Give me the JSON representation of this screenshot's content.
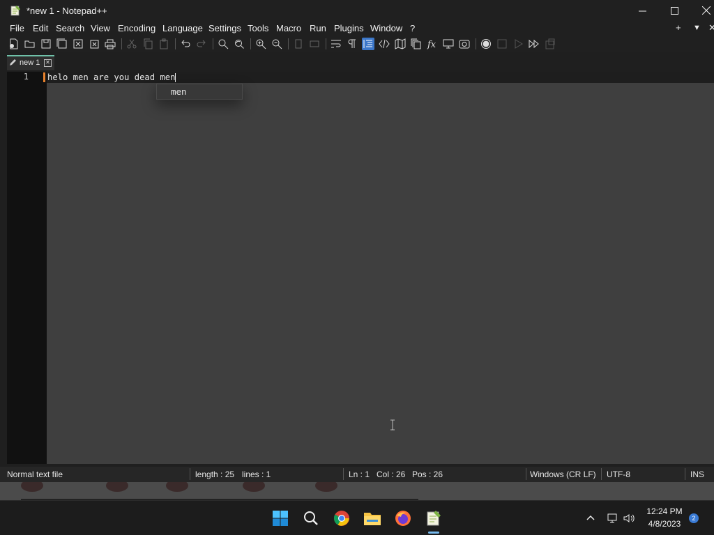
{
  "window": {
    "title": "*new 1 - Notepad++"
  },
  "menu": [
    {
      "label": "File"
    },
    {
      "label": "Edit"
    },
    {
      "label": "Search"
    },
    {
      "label": "View"
    },
    {
      "label": "Encoding"
    },
    {
      "label": "Language"
    },
    {
      "label": "Settings"
    },
    {
      "label": "Tools"
    },
    {
      "label": "Macro"
    },
    {
      "label": "Run"
    },
    {
      "label": "Plugins"
    },
    {
      "label": "Window"
    },
    {
      "label": "?"
    }
  ],
  "menu_right": {
    "add": "+",
    "list": "▼",
    "close": "✕"
  },
  "toolbar": [
    {
      "icon": "new-file-icon"
    },
    {
      "icon": "open-folder-icon"
    },
    {
      "icon": "save-icon"
    },
    {
      "icon": "save-all-icon"
    },
    {
      "icon": "close-file-icon"
    },
    {
      "icon": "close-all-icon"
    },
    {
      "icon": "print-icon"
    },
    {
      "icon": "cut-icon"
    },
    {
      "icon": "copy-icon"
    },
    {
      "icon": "paste-icon"
    },
    {
      "icon": "undo-icon"
    },
    {
      "icon": "redo-icon"
    },
    {
      "icon": "find-icon"
    },
    {
      "icon": "replace-icon"
    },
    {
      "icon": "zoom-in-icon"
    },
    {
      "icon": "zoom-out-icon"
    },
    {
      "icon": "sync-vertical-icon"
    },
    {
      "icon": "sync-horizontal-icon"
    },
    {
      "icon": "word-wrap-icon"
    },
    {
      "icon": "show-all-chars-icon"
    },
    {
      "icon": "indent-guide-icon"
    },
    {
      "icon": "xml-tag-icon"
    },
    {
      "icon": "document-map-icon"
    },
    {
      "icon": "document-list-icon"
    },
    {
      "icon": "function-list-icon"
    },
    {
      "icon": "folder-workspace-icon"
    },
    {
      "icon": "monitoring-icon"
    },
    {
      "icon": "record-macro-icon"
    },
    {
      "icon": "stop-macro-icon"
    },
    {
      "icon": "play-macro-icon"
    },
    {
      "icon": "run-macro-multiple-icon"
    },
    {
      "icon": "save-macro-icon"
    }
  ],
  "tab": {
    "label": "new 1",
    "close": "✕"
  },
  "editor": {
    "line_number": "1",
    "text": "helo men are you dead men",
    "autocomplete": {
      "suggestion": "men"
    }
  },
  "statusbar": {
    "file_type": "Normal text file",
    "length": "length : 25",
    "lines": "lines : 1",
    "ln": "Ln : 1",
    "col": "Col : 26",
    "pos": "Pos : 26",
    "eol": "Windows (CR LF)",
    "encoding": "UTF-8",
    "mode": "INS"
  },
  "taskbar": {
    "apps": [
      {
        "icon": "windows-start-icon"
      },
      {
        "icon": "search-icon"
      },
      {
        "icon": "chrome-icon"
      },
      {
        "icon": "file-explorer-icon"
      },
      {
        "icon": "firefox-icon"
      },
      {
        "icon": "notepadpp-icon"
      }
    ],
    "time": "12:24 PM",
    "date": "4/8/2023",
    "notifications": "2"
  },
  "colors": {
    "accent": "#3c77c9",
    "tab_accent": "#6fc1a9",
    "line_marker": "#e8822d"
  }
}
